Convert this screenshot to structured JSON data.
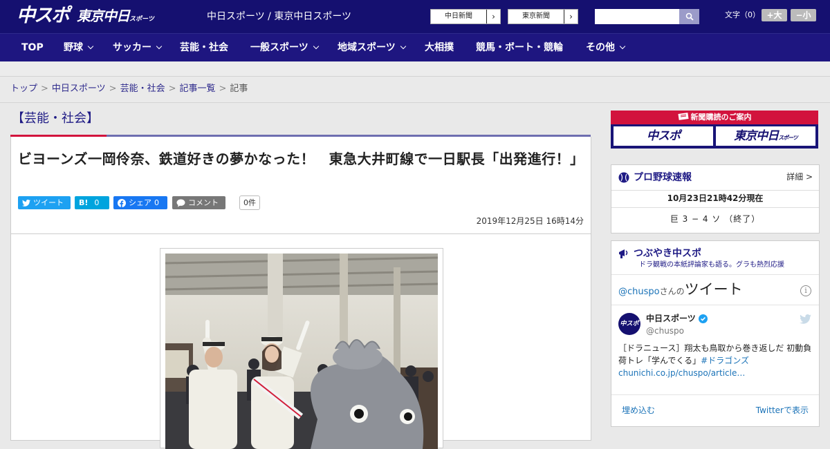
{
  "header": {
    "logo_chuspo": "中スポ",
    "logo_tokyo": "東京中日",
    "logo_tokyo_small": "スポーツ",
    "site_name": "中日スポーツ / 東京中日スポーツ",
    "newspaper_links": [
      "中日新聞",
      "東京新聞"
    ],
    "search": {
      "placeholder": ""
    },
    "fontsize_label": "文字（0）",
    "fontsize_plus": "+大",
    "fontsize_minus": "−小"
  },
  "nav": {
    "items": [
      {
        "label": "TOP",
        "dropdown": false
      },
      {
        "label": "野球",
        "dropdown": true
      },
      {
        "label": "サッカー",
        "dropdown": true
      },
      {
        "label": "芸能・社会",
        "dropdown": false
      },
      {
        "label": "一般スポーツ",
        "dropdown": true
      },
      {
        "label": "地域スポーツ",
        "dropdown": true
      },
      {
        "label": "大相撲",
        "dropdown": false
      },
      {
        "label": "競馬・ボート・競輪",
        "dropdown": false
      },
      {
        "label": "その他",
        "dropdown": true
      }
    ]
  },
  "breadcrumb": {
    "items": [
      "トップ",
      "中日スポーツ",
      "芸能・社会",
      "記事一覧"
    ],
    "current": "記事",
    "separator": ">"
  },
  "category": {
    "title": "【芸能・社会】"
  },
  "article": {
    "title": "ビヨーンズ一岡伶奈、鉄道好きの夢かなった！　東急大井町線で一日駅長「出発進行！」",
    "share": {
      "tweet": "ツイート",
      "hatena_label": "B!",
      "hatena_count": "0",
      "facebook": "シェア",
      "facebook_count": "0",
      "comment": "コメント",
      "comment_count": "0件"
    },
    "date": "2019年12月25日 16時14分"
  },
  "sidebar": {
    "subscribe": {
      "title": "新聞購読のご案内",
      "logo_chuspo": "中スポ",
      "logo_tokyo": "東京中日",
      "logo_tokyo_small": "スポーツ"
    },
    "baseball": {
      "title": "プロ野球速報",
      "detail": "詳細 >",
      "updated": "10月23日21時42分現在",
      "score": "巨 3 − 4 ソ （終了）"
    },
    "twitter": {
      "title": "つぶやき中スポ",
      "subtitle": "ドラ観戦の本紙評論家も語る。グラも熱烈応援",
      "handle_prefix": "@chuspo",
      "handle_suffix": "さんの",
      "tweets_label": "ツイート",
      "info_icon": "i",
      "account_name": "中日スポーツ",
      "account_handle": "@chuspo",
      "avatar_text": "中スポ",
      "tweet_text": "［ドラニュース］翔太も鳥取から巻き返しだ 初動負荷トレ「学んでくる」",
      "tweet_hashtag": "#ドラゴンズ",
      "tweet_link": "chunichi.co.jp/chuspo/article…",
      "embed": "埋め込む",
      "view_on_twitter": "Twitterで表示"
    }
  },
  "colors": {
    "header_bg": "#151070",
    "nav_bg": "#1e1680",
    "accent_red": "#d2133d",
    "twitter_blue": "#1da1f2",
    "hatena_blue": "#00a4de",
    "facebook_blue": "#1877f2",
    "comment_gray": "#777777"
  }
}
